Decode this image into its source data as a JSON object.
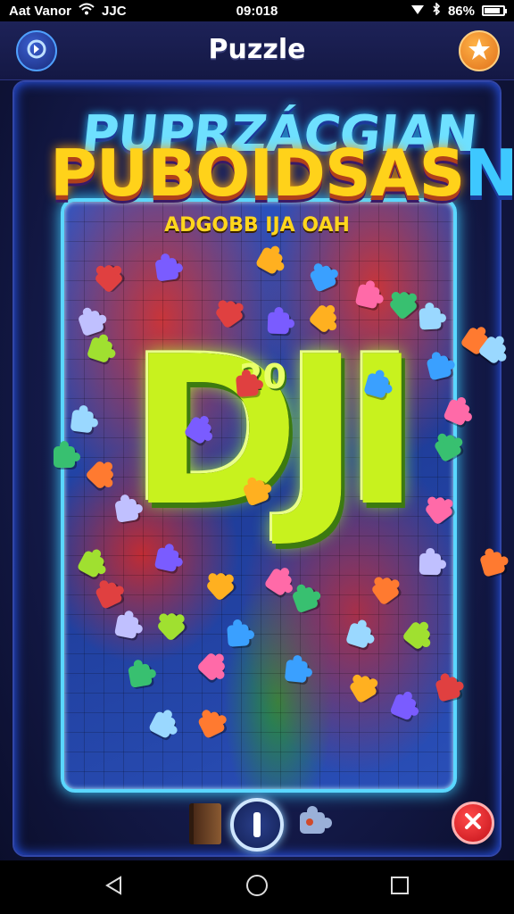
{
  "status_bar": {
    "carrier": "Aat Vanor",
    "extra": "JJC",
    "time": "09:018",
    "battery": "86%",
    "battery_level": 0.86
  },
  "header": {
    "title": "Puzzle",
    "back_icon": "back-icon",
    "star_icon": "star-icon"
  },
  "logo": {
    "line1": "PUPRZÁCGIAN",
    "line2": "PUBOIDSAS",
    "line2_tail": "N"
  },
  "board": {
    "subtitle": "ADGOBB IJA OAH",
    "big_text": "DJI",
    "small_number": "20"
  },
  "pieces": {
    "colors": [
      "#e04040",
      "#7a5cff",
      "#ffb020",
      "#3aa0ff",
      "#ff6aa8",
      "#38c070",
      "#9ad8ff",
      "#ff7a30",
      "#c0c0ff",
      "#a0e030"
    ]
  },
  "controls": {
    "book_icon": "book-icon",
    "pause_icon": "pause-icon",
    "piece_icon": "puzzle-piece-icon",
    "close_icon": "close-icon"
  },
  "navbar": {
    "back": "nav-back-icon",
    "home": "nav-home-icon",
    "recents": "nav-recents-icon"
  },
  "colors": {
    "board_border": "#5ad7ff",
    "score_green": "#c8f21e",
    "title_yellow": "#ffd21a",
    "close_red": "#d81c24"
  }
}
